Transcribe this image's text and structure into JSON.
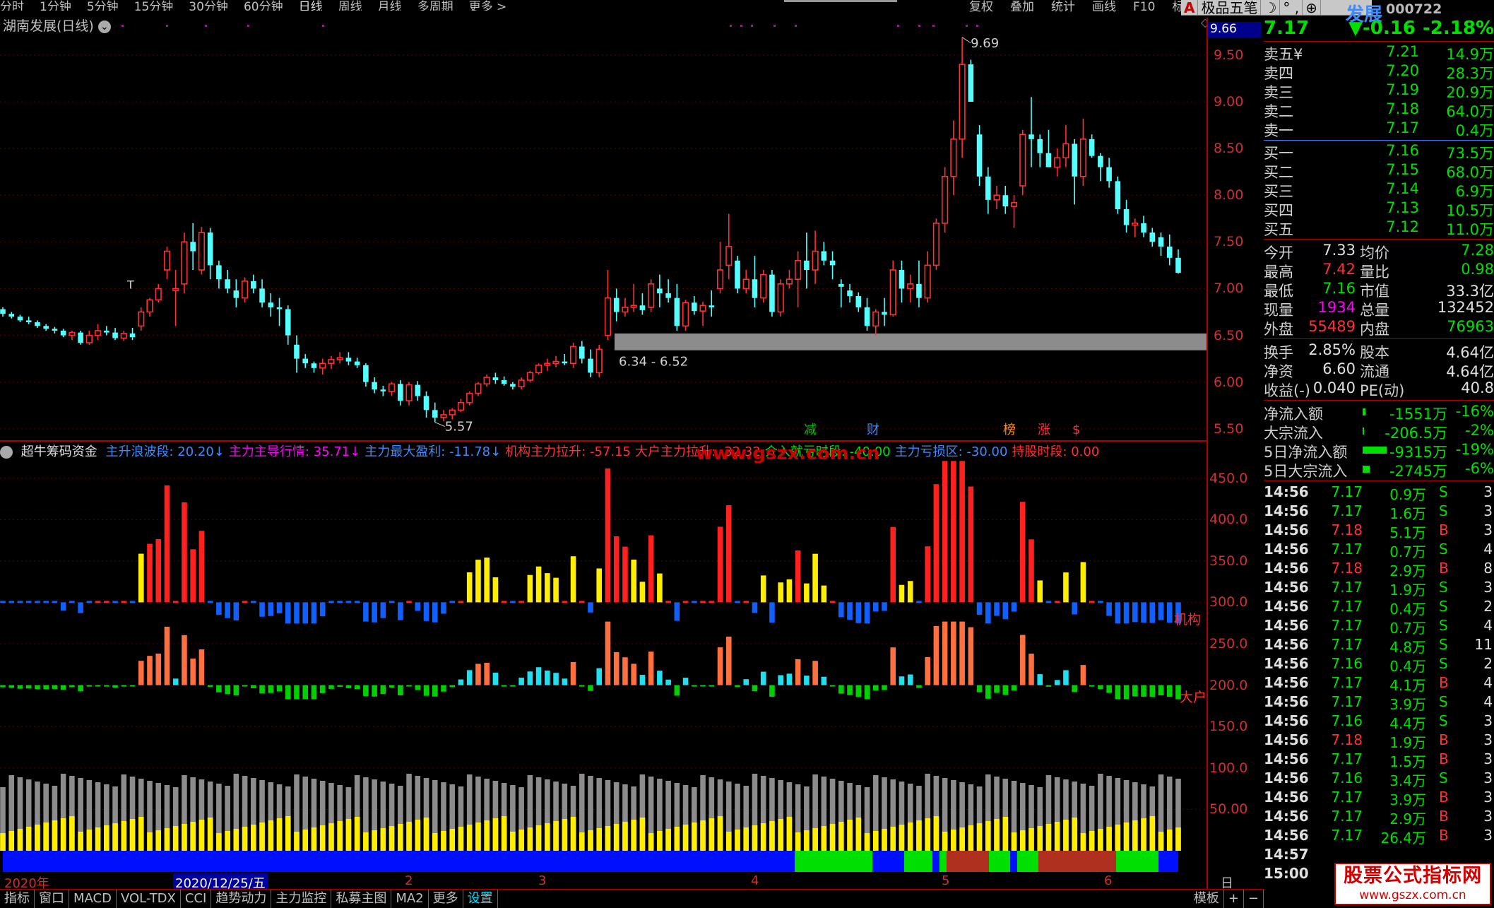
{
  "nav": {
    "items": [
      "分时",
      "1分钟",
      "5分钟",
      "15分钟",
      "30分钟",
      "60分钟",
      "日线",
      "周线",
      "月线",
      "多周期",
      "更多 >"
    ],
    "active": 6
  },
  "nav_right": [
    "复权",
    "叠加",
    "统计",
    "画线",
    "F10",
    "标记"
  ],
  "toolbar2": {
    "btn_a": "A",
    "btn_text": "极品五笔",
    "moon": "☽",
    "dots": "° ,",
    "globe": "⊕"
  },
  "stock": {
    "name_partial": "发展",
    "code": "000722",
    "chart_label": "湖南发展(日线)"
  },
  "price_axis": [
    "9.50",
    "9.00",
    "8.50",
    "8.00",
    "7.50",
    "7.00",
    "6.50",
    "6.00",
    "5.50"
  ],
  "price_tag": "9.66",
  "annotations": {
    "high": "9.69",
    "low": "5.57",
    "band": "6.34 - 6.52",
    "t_mark": "T",
    "events": [
      "减",
      "财",
      "榜",
      "涨",
      "$"
    ]
  },
  "indicator": {
    "name": "超牛筹码资金",
    "params": [
      {
        "label": "主升浪波段: 20.20↓",
        "color": "#3d8bff"
      },
      {
        "label": "主力主导行情: 35.71↓",
        "color": "#ff00ff"
      },
      {
        "label": "主力最大盈利: -11.78↓",
        "color": "#3d8bff"
      },
      {
        "label": "机构主力拉升: -57.15",
        "color": "#ff3030"
      },
      {
        "label": "大户主力拉升: -32.32",
        "color": "#ff3030"
      },
      {
        "label": "介入就亏时段: -40.00",
        "color": "#00e000"
      },
      {
        "label": "主力亏损区: -30.00",
        "color": "#3d8bff"
      },
      {
        "label": "持股时段: 0.00",
        "color": "#ff3030"
      }
    ],
    "axis": [
      "450.0",
      "400.0",
      "350.0",
      "300.0",
      "250.0",
      "200.0",
      "150.0",
      "100.0",
      "50.00"
    ],
    "label_jigou": "机构",
    "label_dahu": "大户"
  },
  "watermark": "www.gszx.com.cn",
  "date_axis": {
    "year": "2020年",
    "cursor_date": "2020/12/25/五",
    "months": [
      "2",
      "3",
      "4",
      "5",
      "6"
    ],
    "period": "日线"
  },
  "bottom_tabs": [
    "指标",
    "窗口",
    "MACD",
    "VOL-TDX",
    "CCI",
    "趋势动力",
    "主力监控",
    "私募主图",
    "MA2",
    "更多",
    "设置"
  ],
  "bottom_right": [
    "模板",
    "+",
    "−"
  ],
  "quote": {
    "price": "7.17",
    "change": "▼-0.16",
    "pct": "-2.18%"
  },
  "order_book": {
    "sell": [
      {
        "label": "卖五",
        "price": "7.21",
        "vol": "14.9万",
        "extra": "¥"
      },
      {
        "label": "卖四",
        "price": "7.20",
        "vol": "28.3万"
      },
      {
        "label": "卖三",
        "price": "7.19",
        "vol": "20.9万"
      },
      {
        "label": "卖二",
        "price": "7.18",
        "vol": "64.0万"
      },
      {
        "label": "卖一",
        "price": "7.17",
        "vol": "0.4万"
      }
    ],
    "buy": [
      {
        "label": "买一",
        "price": "7.16",
        "vol": "73.5万"
      },
      {
        "label": "买二",
        "price": "7.15",
        "vol": "68.0万"
      },
      {
        "label": "买三",
        "price": "7.14",
        "vol": "6.9万"
      },
      {
        "label": "买四",
        "price": "7.13",
        "vol": "10.5万"
      },
      {
        "label": "买五",
        "price": "7.12",
        "vol": "11.0万"
      }
    ]
  },
  "stats": [
    {
      "l1": "今开",
      "v1": "7.33",
      "c1": "#e0e0e0",
      "l2": "均价",
      "v2": "7.28",
      "c2": "#00e000"
    },
    {
      "l1": "最高",
      "v1": "7.42",
      "c1": "#ff3030",
      "l2": "量比",
      "v2": "0.98",
      "c2": "#00e000"
    },
    {
      "l1": "最低",
      "v1": "7.16",
      "c1": "#00e000",
      "l2": "市值",
      "v2": "33.3亿",
      "c2": "#e0e0e0"
    },
    {
      "l1": "现量",
      "v1": "1934",
      "c1": "#ff00ff",
      "l2": "总量",
      "v2": "132452",
      "c2": "#e0e0e0"
    },
    {
      "l1": "外盘",
      "v1": "55489",
      "c1": "#ff3030",
      "l2": "内盘",
      "v2": "76963",
      "c2": "#00e000"
    }
  ],
  "stats2": [
    {
      "l1": "换手",
      "v1": "2.85%",
      "l2": "股本",
      "v2": "4.64亿"
    },
    {
      "l1": "净资",
      "v1": "6.60",
      "l2": "流通",
      "v2": "4.64亿"
    },
    {
      "l1": "收益(-)",
      "v1": "0.040",
      "l2": "PE(动)",
      "v2": "40.8"
    }
  ],
  "flows": [
    {
      "label": "净流入额",
      "value": "-1551万",
      "pct": "-16%",
      "bar": 4
    },
    {
      "label": "大宗流入",
      "value": "-206.5万",
      "pct": "-2%",
      "bar": 2
    },
    {
      "label": "5日净流入额",
      "value": "-9315万",
      "pct": "-19%",
      "bar": 34
    },
    {
      "label": "5日大宗流入",
      "value": "-2745万",
      "pct": "-6%",
      "bar": 10
    }
  ],
  "ticks": [
    {
      "t": "14:56",
      "p": "7.17",
      "v": "0.9万",
      "d": "S",
      "n": "3"
    },
    {
      "t": "14:56",
      "p": "7.17",
      "v": "1.6万",
      "d": "S",
      "n": "3"
    },
    {
      "t": "14:56",
      "p": "7.18",
      "v": "5.1万",
      "d": "B",
      "n": "3"
    },
    {
      "t": "14:56",
      "p": "7.17",
      "v": "0.7万",
      "d": "S",
      "n": "4"
    },
    {
      "t": "14:56",
      "p": "7.18",
      "v": "2.9万",
      "d": "B",
      "n": "8"
    },
    {
      "t": "14:56",
      "p": "7.17",
      "v": "1.9万",
      "d": "S",
      "n": "3"
    },
    {
      "t": "14:56",
      "p": "7.17",
      "v": "0.4万",
      "d": "S",
      "n": "2"
    },
    {
      "t": "14:56",
      "p": "7.17",
      "v": "0.7万",
      "d": "S",
      "n": "4"
    },
    {
      "t": "14:56",
      "p": "7.17",
      "v": "4.8万",
      "d": "S",
      "n": "11"
    },
    {
      "t": "14:56",
      "p": "7.16",
      "v": "0.4万",
      "d": "S",
      "n": "2"
    },
    {
      "t": "14:56",
      "p": "7.17",
      "v": "4.1万",
      "d": "B",
      "n": "4"
    },
    {
      "t": "14:56",
      "p": "7.17",
      "v": "3.9万",
      "d": "S",
      "n": "4"
    },
    {
      "t": "14:56",
      "p": "7.16",
      "v": "4.4万",
      "d": "S",
      "n": "3"
    },
    {
      "t": "14:56",
      "p": "7.18",
      "v": "1.9万",
      "d": "B",
      "n": "3"
    },
    {
      "t": "14:56",
      "p": "7.17",
      "v": "1.5万",
      "d": "B",
      "n": "3"
    },
    {
      "t": "14:56",
      "p": "7.16",
      "v": "3.4万",
      "d": "S",
      "n": "3"
    },
    {
      "t": "14:56",
      "p": "7.17",
      "v": "3.9万",
      "d": "B",
      "n": "3"
    },
    {
      "t": "14:56",
      "p": "7.17",
      "v": "2.9万",
      "d": "B",
      "n": "3"
    },
    {
      "t": "14:56",
      "p": "7.17",
      "v": "26.4万",
      "d": "B",
      "n": "3"
    },
    {
      "t": "14:57",
      "p": "",
      "v": "",
      "d": "",
      "n": ""
    },
    {
      "t": "15:00",
      "p": "",
      "v": "",
      "d": "",
      "n": ""
    }
  ],
  "logo": {
    "line1": "股票公式指标网",
    "line2": "www.gszx.com.cn"
  },
  "colors": {
    "up": "#ff3030",
    "down": "#54ffff",
    "grid": "#5a0000",
    "border": "#aa0000"
  },
  "chart_data": {
    "type": "candlestick",
    "title": "湖南发展(日线)",
    "ylim": [
      5.4,
      9.9
    ],
    "ohlc": [
      [
        6.78,
        6.8,
        6.7,
        6.73
      ],
      [
        6.73,
        6.75,
        6.68,
        6.7
      ],
      [
        6.7,
        6.72,
        6.64,
        6.66
      ],
      [
        6.66,
        6.7,
        6.62,
        6.64
      ],
      [
        6.64,
        6.66,
        6.58,
        6.6
      ],
      [
        6.6,
        6.62,
        6.55,
        6.57
      ],
      [
        6.57,
        6.59,
        6.52,
        6.55
      ],
      [
        6.55,
        6.57,
        6.48,
        6.5
      ],
      [
        6.5,
        6.55,
        6.45,
        6.53
      ],
      [
        6.53,
        6.55,
        6.4,
        6.42
      ],
      [
        6.42,
        6.55,
        6.4,
        6.5
      ],
      [
        6.5,
        6.62,
        6.45,
        6.55
      ],
      [
        6.55,
        6.6,
        6.5,
        6.53
      ],
      [
        6.53,
        6.58,
        6.45,
        6.47
      ],
      [
        6.47,
        6.55,
        6.44,
        6.52
      ],
      [
        6.52,
        6.58,
        6.45,
        6.48
      ],
      [
        6.6,
        6.8,
        6.55,
        6.75
      ],
      [
        6.75,
        6.9,
        6.7,
        6.88
      ],
      [
        6.88,
        7.05,
        6.85,
        7.0
      ],
      [
        7.2,
        7.45,
        7.1,
        7.4
      ],
      [
        6.98,
        7.2,
        6.6,
        7.0
      ],
      [
        7.05,
        7.6,
        6.95,
        7.5
      ],
      [
        7.5,
        7.7,
        7.2,
        7.4
      ],
      [
        7.2,
        7.66,
        7.15,
        7.6
      ],
      [
        7.6,
        7.65,
        7.1,
        7.25
      ],
      [
        7.25,
        7.3,
        7.0,
        7.1
      ],
      [
        7.1,
        7.2,
        6.95,
        7.0
      ],
      [
        6.98,
        7.1,
        6.8,
        6.9
      ],
      [
        6.9,
        7.12,
        6.85,
        7.08
      ],
      [
        7.08,
        7.15,
        6.95,
        7.0
      ],
      [
        7.0,
        7.1,
        6.8,
        6.85
      ],
      [
        6.85,
        6.95,
        6.7,
        6.8
      ],
      [
        6.8,
        6.9,
        6.6,
        6.78
      ],
      [
        6.78,
        6.82,
        6.4,
        6.5
      ],
      [
        6.4,
        6.5,
        6.1,
        6.25
      ],
      [
        6.25,
        6.3,
        6.15,
        6.2
      ],
      [
        6.2,
        6.22,
        6.1,
        6.15
      ],
      [
        6.15,
        6.25,
        6.08,
        6.2
      ],
      [
        6.2,
        6.28,
        6.14,
        6.24
      ],
      [
        6.24,
        6.32,
        6.2,
        6.26
      ],
      [
        6.26,
        6.32,
        6.18,
        6.22
      ],
      [
        6.22,
        6.26,
        6.15,
        6.18
      ],
      [
        6.18,
        6.2,
        5.95,
        6.0
      ],
      [
        6.0,
        6.05,
        5.88,
        5.92
      ],
      [
        5.92,
        5.96,
        5.85,
        5.9
      ],
      [
        5.9,
        6.0,
        5.85,
        5.98
      ],
      [
        5.98,
        6.02,
        5.75,
        5.8
      ],
      [
        5.8,
        6.0,
        5.75,
        5.97
      ],
      [
        5.97,
        6.01,
        5.8,
        5.85
      ],
      [
        5.85,
        5.9,
        5.62,
        5.7
      ],
      [
        5.7,
        5.78,
        5.57,
        5.62
      ],
      [
        5.62,
        5.7,
        5.58,
        5.65
      ],
      [
        5.65,
        5.72,
        5.6,
        5.7
      ],
      [
        5.7,
        5.82,
        5.68,
        5.78
      ],
      [
        5.78,
        5.9,
        5.75,
        5.88
      ],
      [
        5.88,
        6.0,
        5.85,
        5.98
      ],
      [
        5.98,
        6.08,
        5.95,
        6.05
      ],
      [
        6.05,
        6.1,
        5.98,
        6.02
      ],
      [
        6.02,
        6.06,
        5.96,
        5.98
      ],
      [
        5.98,
        6.0,
        5.92,
        5.95
      ],
      [
        5.95,
        6.05,
        5.92,
        6.02
      ],
      [
        6.02,
        6.12,
        6.0,
        6.1
      ],
      [
        6.1,
        6.2,
        6.08,
        6.18
      ],
      [
        6.18,
        6.25,
        6.12,
        6.2
      ],
      [
        6.2,
        6.28,
        6.16,
        6.22
      ],
      [
        6.22,
        6.3,
        6.18,
        6.2
      ],
      [
        6.2,
        6.42,
        6.15,
        6.38
      ],
      [
        6.38,
        6.44,
        6.2,
        6.25
      ],
      [
        6.25,
        6.35,
        6.05,
        6.1
      ],
      [
        6.1,
        6.4,
        6.05,
        6.35
      ],
      [
        6.5,
        7.2,
        6.45,
        6.9
      ],
      [
        6.9,
        7.0,
        6.65,
        6.75
      ],
      [
        6.75,
        6.9,
        6.7,
        6.8
      ],
      [
        6.8,
        7.05,
        6.75,
        6.82
      ],
      [
        6.82,
        6.95,
        6.72,
        6.77
      ],
      [
        6.8,
        7.1,
        6.75,
        7.05
      ],
      [
        7.0,
        7.15,
        6.8,
        6.95
      ],
      [
        6.95,
        7.1,
        6.85,
        6.9
      ],
      [
        6.9,
        7.05,
        6.55,
        6.6
      ],
      [
        6.6,
        6.88,
        6.55,
        6.85
      ],
      [
        6.85,
        6.92,
        6.72,
        6.76
      ],
      [
        6.76,
        6.86,
        6.6,
        6.82
      ],
      [
        6.82,
        6.98,
        6.7,
        6.8
      ],
      [
        7.0,
        7.5,
        6.95,
        7.2
      ],
      [
        7.25,
        7.8,
        7.1,
        7.45
      ],
      [
        7.3,
        7.35,
        6.95,
        7.0
      ],
      [
        7.0,
        7.2,
        6.95,
        7.1
      ],
      [
        7.1,
        7.35,
        6.8,
        6.9
      ],
      [
        6.9,
        7.2,
        6.85,
        7.15
      ],
      [
        7.15,
        7.2,
        6.7,
        6.75
      ],
      [
        6.75,
        7.1,
        6.7,
        7.05
      ],
      [
        7.05,
        7.2,
        7.0,
        7.1
      ],
      [
        7.1,
        7.4,
        6.8,
        7.3
      ],
      [
        7.3,
        7.6,
        7.0,
        7.2
      ],
      [
        7.2,
        7.62,
        7.05,
        7.4
      ],
      [
        7.4,
        7.5,
        7.25,
        7.3
      ],
      [
        7.3,
        7.4,
        7.1,
        7.25
      ],
      [
        7.05,
        7.1,
        6.8,
        7.02
      ],
      [
        6.98,
        7.05,
        6.85,
        6.92
      ],
      [
        6.92,
        6.96,
        6.75,
        6.8
      ],
      [
        6.8,
        6.9,
        6.55,
        6.6
      ],
      [
        6.6,
        6.78,
        6.5,
        6.75
      ],
      [
        6.75,
        6.9,
        6.6,
        6.72
      ],
      [
        6.72,
        7.3,
        6.7,
        7.2
      ],
      [
        7.2,
        7.3,
        6.85,
        7.0
      ],
      [
        7.0,
        7.15,
        6.85,
        7.05
      ],
      [
        7.05,
        7.3,
        6.8,
        6.9
      ],
      [
        6.9,
        7.4,
        6.85,
        7.25
      ],
      [
        7.25,
        7.75,
        7.2,
        7.7
      ],
      [
        7.7,
        8.3,
        7.6,
        8.2
      ],
      [
        8.2,
        8.8,
        8.0,
        8.6
      ],
      [
        8.6,
        9.69,
        8.4,
        9.4
      ],
      [
        9.4,
        9.45,
        9.0,
        9.0
      ],
      [
        8.65,
        8.75,
        8.1,
        8.2
      ],
      [
        8.2,
        8.3,
        7.8,
        7.95
      ],
      [
        7.95,
        8.1,
        7.85,
        8.0
      ],
      [
        8.0,
        8.1,
        7.8,
        7.88
      ],
      [
        7.88,
        8.0,
        7.65,
        7.92
      ],
      [
        8.1,
        8.7,
        8.0,
        8.65
      ],
      [
        8.65,
        9.05,
        8.3,
        8.6
      ],
      [
        8.6,
        8.65,
        8.3,
        8.45
      ],
      [
        8.45,
        8.7,
        8.3,
        8.3
      ],
      [
        8.3,
        8.5,
        8.2,
        8.4
      ],
      [
        8.4,
        8.75,
        8.3,
        8.55
      ],
      [
        8.55,
        8.6,
        7.9,
        8.2
      ],
      [
        8.2,
        8.82,
        8.1,
        8.6
      ],
      [
        8.6,
        8.65,
        8.4,
        8.42
      ],
      [
        8.42,
        8.45,
        8.15,
        8.3
      ],
      [
        8.3,
        8.4,
        8.08,
        8.15
      ],
      [
        8.15,
        8.2,
        7.8,
        7.85
      ],
      [
        7.85,
        7.95,
        7.6,
        7.68
      ],
      [
        7.68,
        7.75,
        7.55,
        7.7
      ],
      [
        7.7,
        7.78,
        7.55,
        7.6
      ],
      [
        7.6,
        7.65,
        7.45,
        7.5
      ],
      [
        7.55,
        7.6,
        7.35,
        7.45
      ],
      [
        7.45,
        7.58,
        7.25,
        7.33
      ],
      [
        7.33,
        7.42,
        7.16,
        7.17
      ]
    ],
    "support_band": [
      6.34,
      6.52
    ],
    "marked_high": 9.69,
    "marked_low": 5.57
  }
}
